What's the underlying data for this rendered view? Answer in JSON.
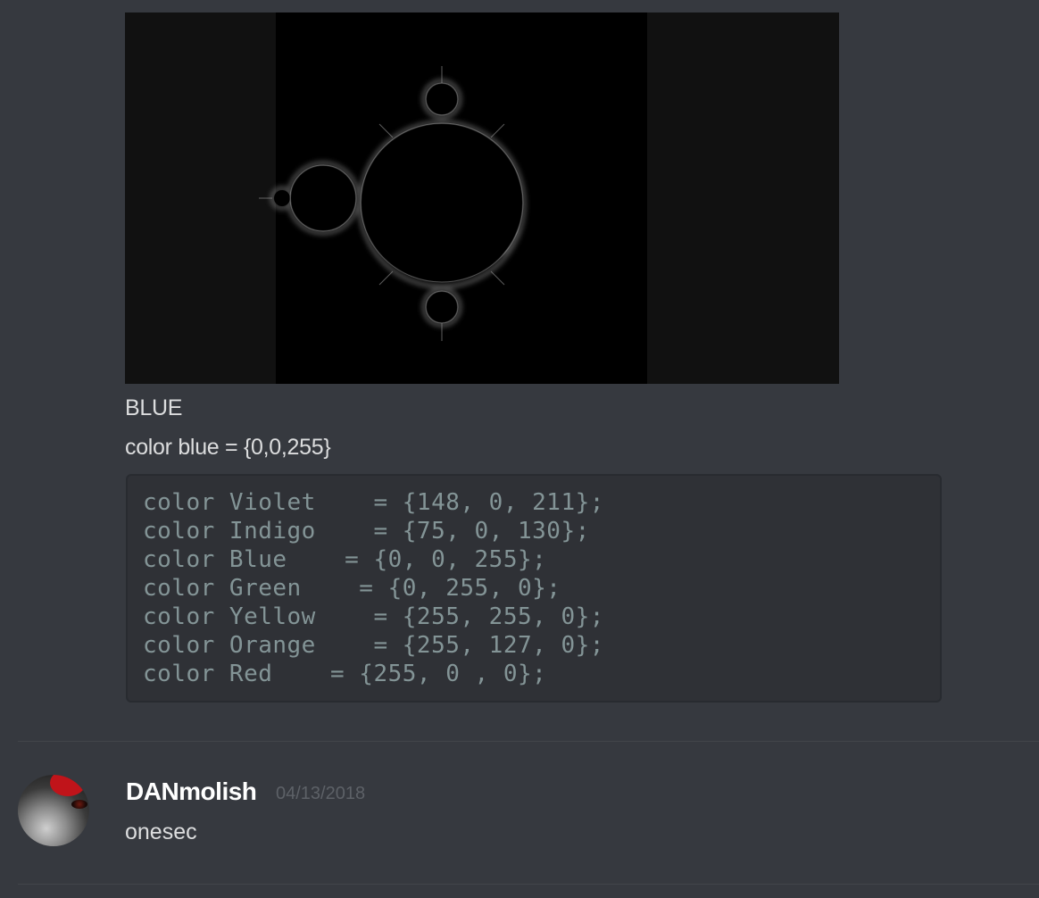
{
  "prev_message": {
    "attachment_name": "mandelbrot-fractal-image",
    "line1": "BLUE",
    "line2": "color blue = {0,0,255}",
    "code_lines": [
      "color Violet    = {148, 0, 211};",
      "color Indigo    = {75, 0, 130};",
      "color Blue    = {0, 0, 255};",
      "color Green    = {0, 255, 0};",
      "color Yellow    = {255, 255, 0};",
      "color Orange    = {255, 127, 0};",
      "color Red    = {255, 0 , 0};"
    ]
  },
  "message": {
    "username": "DANmolish",
    "timestamp": "04/13/2018",
    "text": "onesec",
    "avatar_icon": "avatar-image"
  },
  "colors": {
    "background": "#36393f",
    "code_background": "#2f3136",
    "code_text": "#839496",
    "text": "#dcddde",
    "username": "#ffffff",
    "timestamp": "#5d6167"
  }
}
